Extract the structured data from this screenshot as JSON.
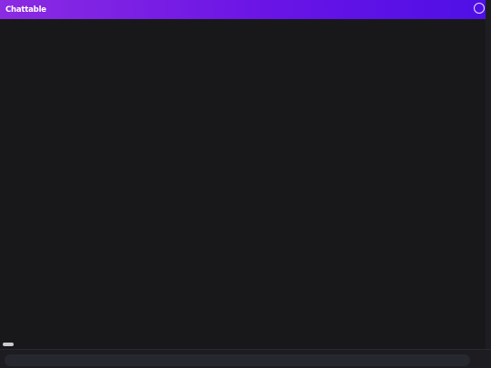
{
  "app": {
    "title": "Chattable"
  },
  "composer": {
    "placeholder": "",
    "value": ""
  },
  "messages": []
}
